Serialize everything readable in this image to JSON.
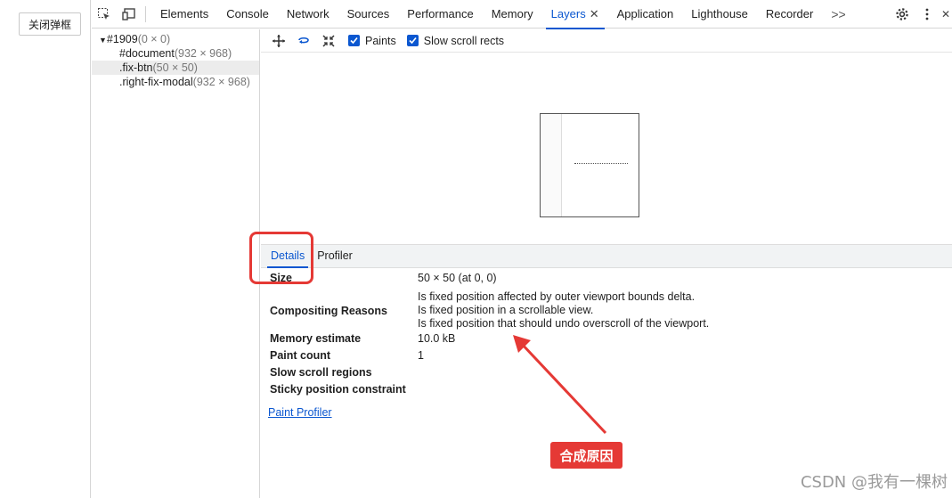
{
  "page": {
    "close_button": "关闭弹框"
  },
  "devtools": {
    "tabs": [
      {
        "label": "Elements"
      },
      {
        "label": "Console"
      },
      {
        "label": "Network"
      },
      {
        "label": "Sources"
      },
      {
        "label": "Performance"
      },
      {
        "label": "Memory"
      },
      {
        "label": "Layers",
        "active": true
      },
      {
        "label": "Application"
      },
      {
        "label": "Lighthouse"
      },
      {
        "label": "Recorder"
      }
    ],
    "more_label": ">>"
  },
  "layer_tree": {
    "root": {
      "name": "#1909",
      "size": "(0 × 0)"
    },
    "children": [
      {
        "name": "#document",
        "size": "(932 × 968)"
      },
      {
        "name": ".fix-btn",
        "size": "(50 × 50)",
        "selected": true
      },
      {
        "name": ".right-fix-modal",
        "size": "(932 × 968)"
      }
    ]
  },
  "layer_toolbar": {
    "paints_label": "Paints",
    "slow_scroll_label": "Slow scroll rects"
  },
  "details_tabs": {
    "details": "Details",
    "profiler": "Profiler"
  },
  "details": {
    "size_key": "Size",
    "size_val": "50 × 50 (at 0, 0)",
    "compositing_key": "Compositing Reasons",
    "compositing_reasons": [
      "Is fixed position affected by outer viewport bounds delta.",
      "Is fixed position in a scrollable view.",
      "Is fixed position that should undo overscroll of the viewport."
    ],
    "memory_key": "Memory estimate",
    "memory_val": "10.0 kB",
    "paint_count_key": "Paint count",
    "paint_count_val": "1",
    "slow_scroll_key": "Slow scroll regions",
    "sticky_key": "Sticky position constraint",
    "paint_profiler_link": "Paint Profiler"
  },
  "annotation": {
    "label": "合成原因",
    "color": "#e53935"
  },
  "watermark": "CSDN @我有一棵树"
}
